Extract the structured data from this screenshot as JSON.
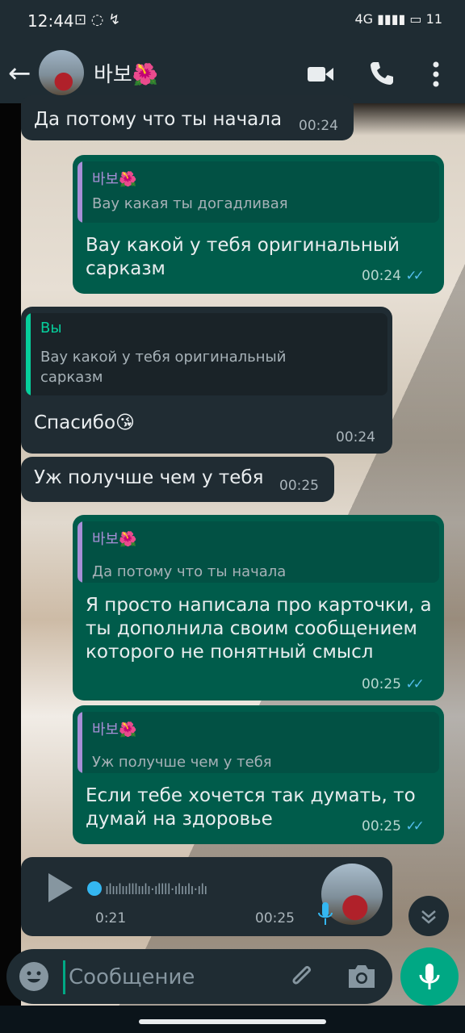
{
  "status": {
    "time": "12:44",
    "battery": "11",
    "network": "4G"
  },
  "header": {
    "contact_name": "바보🌺"
  },
  "colors": {
    "header": "#1f2c33",
    "incoming": "#202c33",
    "outgoing": "#005c4b",
    "accent": "#00a884",
    "read_ticks": "#53bdeb"
  },
  "messages": [
    {
      "dir": "in",
      "text": "Да потому что ты начала",
      "time": "00:24"
    },
    {
      "dir": "out",
      "quote_author": "바보🌺",
      "quote_text": "Вау какая ты догадливая",
      "text": [
        "Вау какой у тебя оригинальный",
        "сарказм"
      ],
      "time": "00:24",
      "read": true
    },
    {
      "dir": "in",
      "quote_author": "Вы",
      "quote_text": [
        "Вау какой у тебя оригинальный",
        "сарказм"
      ],
      "text": "Спасибо😘",
      "time": "00:24"
    },
    {
      "dir": "in",
      "text": "Уж получше чем у тебя",
      "time": "00:25"
    },
    {
      "dir": "out",
      "quote_author": "바보🌺",
      "quote_text": "Да потому что ты начала",
      "text": [
        "Я просто написала про карточки, а",
        "ты дополнила своим сообщением",
        "которого не понятный смысл"
      ],
      "time": "00:25",
      "read": true
    },
    {
      "dir": "out",
      "quote_author": "바보🌺",
      "quote_text": "Уж получше чем у тебя",
      "text": [
        "Если тебе хочется так думать, то",
        "думай на здоровье"
      ],
      "time": "00:25",
      "read": true
    }
  ],
  "voice_message": {
    "duration": "0:21",
    "time": "00:25"
  },
  "composer": {
    "placeholder": "Сообщение"
  },
  "icons": [
    "back-arrow-icon",
    "video-call-icon",
    "phone-icon",
    "more-vert-icon",
    "play-icon",
    "mic-icon",
    "chevron-down-icon",
    "emoji-icon",
    "attach-icon",
    "camera-icon",
    "send-mic-icon"
  ]
}
